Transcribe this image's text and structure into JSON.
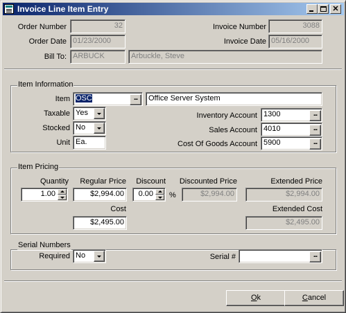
{
  "window": {
    "title": "Invoice Line Item Entry"
  },
  "header": {
    "order_number_label": "Order Number",
    "order_number": "32",
    "invoice_number_label": "Invoice Number",
    "invoice_number": "3088",
    "order_date_label": "Order Date",
    "order_date": "01/23/2000",
    "invoice_date_label": "Invoice Date",
    "invoice_date": "05/16/2000",
    "bill_to_label": "Bill To:",
    "bill_to_code": "ARBUCK",
    "bill_to_name": "Arbuckle, Steve"
  },
  "item_info": {
    "group_label": "Item Information",
    "item_label": "Item",
    "item_code": "OSC",
    "item_description": "Office Server System",
    "taxable_label": "Taxable",
    "taxable": "Yes",
    "stocked_label": "Stocked",
    "stocked": "No",
    "unit_label": "Unit",
    "unit": "Ea.",
    "inventory_account_label": "Inventory Account",
    "inventory_account": "1300",
    "sales_account_label": "Sales Account",
    "sales_account": "4010",
    "cogs_account_label": "Cost Of Goods Account",
    "cogs_account": "5900"
  },
  "item_pricing": {
    "group_label": "Item Pricing",
    "quantity_label": "Quantity",
    "quantity": "1.00",
    "regular_price_label": "Regular Price",
    "regular_price": "$2,994.00",
    "discount_label": "Discount",
    "discount": "0.00",
    "percent_sign": "%",
    "discounted_price_label": "Discounted Price",
    "discounted_price": "$2,994.00",
    "extended_price_label": "Extended Price",
    "extended_price": "$2,994.00",
    "cost_label": "Cost",
    "cost": "$2,495.00",
    "extended_cost_label": "Extended Cost",
    "extended_cost": "$2,495.00"
  },
  "serial_numbers": {
    "group_label": "Serial Numbers",
    "required_label": "Required",
    "required": "No",
    "serial_label": "Serial #",
    "serial": ""
  },
  "buttons": {
    "ok_key": "O",
    "ok_rest": "k",
    "cancel_key": "C",
    "cancel_rest": "ancel",
    "ellipsis": "..."
  },
  "icons": {
    "window_icon": "form-icon",
    "minimize": "minimize-icon",
    "maximize": "maximize-icon",
    "close": "close-icon"
  }
}
